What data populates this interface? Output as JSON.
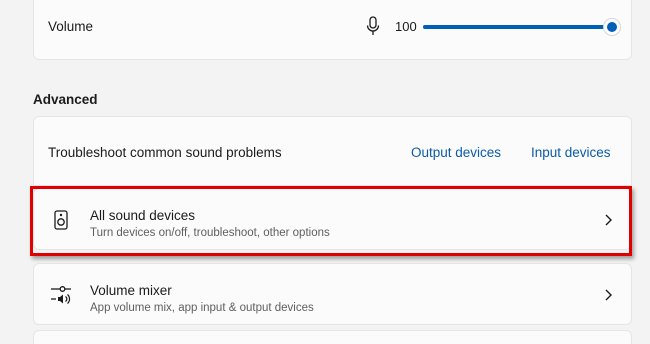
{
  "volume": {
    "label": "Volume",
    "value_text": "100",
    "level_percent": 100
  },
  "advanced": {
    "heading": "Advanced",
    "troubleshoot": {
      "label": "Troubleshoot common sound problems",
      "output_link": "Output devices",
      "input_link": "Input devices"
    },
    "items": [
      {
        "title": "All sound devices",
        "subtitle": "Turn devices on/off, troubleshoot, other options",
        "icon": "speaker-icon"
      },
      {
        "title": "Volume mixer",
        "subtitle": "App volume mix, app input & output devices",
        "icon": "volume-mixer-icon"
      }
    ]
  },
  "colors": {
    "accent": "#005fb8",
    "link": "#0a5ca8",
    "highlight": "#e00000"
  }
}
